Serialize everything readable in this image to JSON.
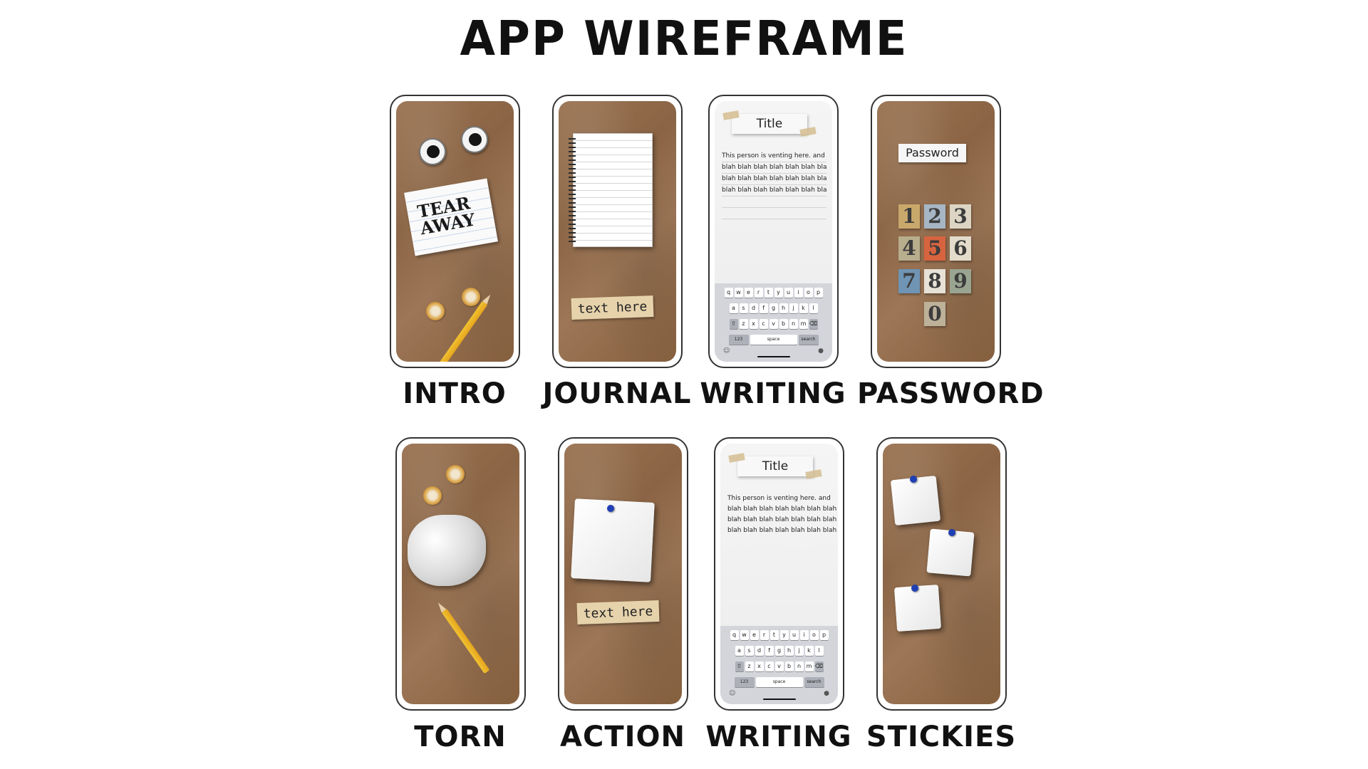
{
  "header": {
    "title": "APP WIREFRAME"
  },
  "screens": [
    {
      "label": "INTRO"
    },
    {
      "label": "JOURNAL"
    },
    {
      "label": "WRITING"
    },
    {
      "label": "PASSWORD"
    },
    {
      "label": "TORN"
    },
    {
      "label": "ACTION"
    },
    {
      "label": "WRITING"
    },
    {
      "label": "STICKIES"
    }
  ],
  "intro": {
    "logo_text": "TEAR AWAY"
  },
  "journal": {
    "tape_text": "text here"
  },
  "action": {
    "tape_text": "text here"
  },
  "writing": {
    "title": "Title",
    "body_lines": [
      "This person is venting here. and",
      "blah blah blah blah blah blah blah",
      "blah blah blah blah blah blah blah",
      "blah blah blah blah blah blah blah"
    ],
    "keyboard": {
      "row1": [
        "q",
        "w",
        "e",
        "r",
        "t",
        "y",
        "u",
        "i",
        "o",
        "p"
      ],
      "row2": [
        "a",
        "s",
        "d",
        "f",
        "g",
        "h",
        "j",
        "k",
        "l"
      ],
      "row3": [
        "z",
        "x",
        "c",
        "v",
        "b",
        "n",
        "m"
      ],
      "numbers_key": "123",
      "space_key": "space",
      "search_key": "search"
    }
  },
  "password": {
    "label": "Password",
    "keys": [
      "1",
      "2",
      "3",
      "4",
      "5",
      "6",
      "7",
      "8",
      "9",
      "0"
    ],
    "key_colors": [
      "#c9a86b",
      "#a7b6c4",
      "#dcd5c4",
      "#b8ad8d",
      "#d7643f",
      "#e4dccb",
      "#6f94b4",
      "#e8e2d6",
      "#9aa591",
      "#bdb19a"
    ]
  }
}
